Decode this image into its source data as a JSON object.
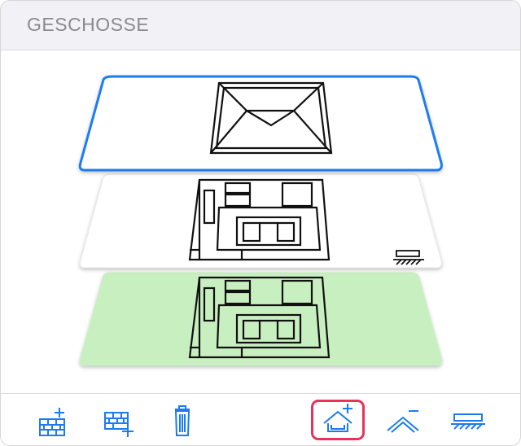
{
  "panel": {
    "title": "GESCHOSSE"
  },
  "floors": [
    {
      "name": "roof",
      "state": "selected",
      "icon": "roof-plan"
    },
    {
      "name": "upper-floor",
      "state": "normal",
      "icon": "floor-plan"
    },
    {
      "name": "ground-floor",
      "state": "highlighted",
      "icon": "floor-plan"
    }
  ],
  "toolbar": {
    "buttons": [
      {
        "name": "add-floor-above-button",
        "icon": "wall-plus-icon",
        "active": false
      },
      {
        "name": "add-floor-below-button",
        "icon": "wall-plus-below-icon",
        "active": false
      },
      {
        "name": "delete-floor-button",
        "icon": "trash-icon",
        "active": false
      },
      {
        "name": "add-roof-button",
        "icon": "roof-plus-icon",
        "active": true
      },
      {
        "name": "remove-roof-button",
        "icon": "roof-minus-icon",
        "active": false
      },
      {
        "name": "foundation-button",
        "icon": "foundation-icon",
        "active": false
      }
    ]
  },
  "colors": {
    "accent": "#1a7cf0",
    "active_border": "#e8325a",
    "ground_fill": "#c8efbf",
    "header_bg": "#f2f2f6"
  }
}
